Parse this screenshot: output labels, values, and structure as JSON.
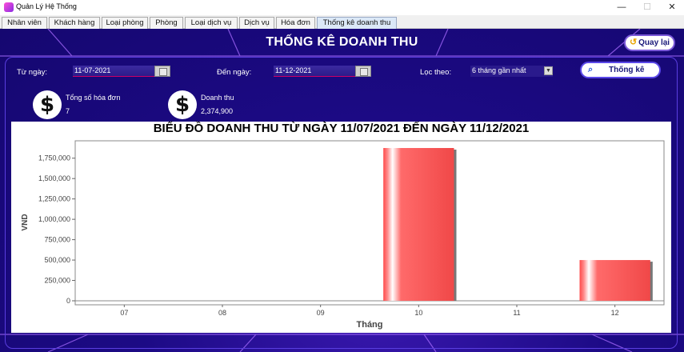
{
  "window": {
    "title": "Quản Lý Hệ Thống",
    "min": "—",
    "max": "☐",
    "close": "✕"
  },
  "tabs": [
    {
      "label": "Nhân viên"
    },
    {
      "label": "Khách hàng"
    },
    {
      "label": "Loại phòng"
    },
    {
      "label": "Phòng"
    },
    {
      "label": "Loại dịch vụ"
    },
    {
      "label": "Dịch vụ"
    },
    {
      "label": "Hóa đơn"
    },
    {
      "label": "Thống kê doanh thu",
      "active": true
    }
  ],
  "header": {
    "title": "THỐNG KÊ DOANH THU",
    "back_label": "Quay lại",
    "back_icon": "undo-arrow-icon"
  },
  "filters": {
    "from_label": "Từ ngày:",
    "from_value": "11-07-2021",
    "to_label": "Đến ngày:",
    "to_value": "11-12-2021",
    "filter_label": "Lọc theo:",
    "filter_value": "6 tháng gần nhất",
    "submit_label": "Thống kê",
    "submit_icon": "search-icon"
  },
  "stats": {
    "invoices_label": "Tổng số hóa đơn",
    "invoices_value": "7",
    "revenue_label": "Doanh thu",
    "revenue_value": "2,374,900",
    "icon_glyph": "$"
  },
  "colors": {
    "background": "#1c0a85",
    "bar": "#ff4a4a"
  },
  "chart_data": {
    "type": "bar",
    "title": "BIỂU ĐỒ DOANH THU TỪ NGÀY 11/07/2021 ĐẾN NGÀY 11/12/2021",
    "xlabel": "Tháng",
    "ylabel": "VND",
    "categories": [
      "07",
      "08",
      "09",
      "10",
      "11",
      "12"
    ],
    "values": [
      0,
      0,
      0,
      1874900,
      0,
      500000
    ],
    "ylim": [
      0,
      1875000
    ],
    "yticks": [
      0,
      250000,
      500000,
      750000,
      1000000,
      1250000,
      1500000,
      1750000
    ],
    "ytick_labels": [
      "0",
      "250,000",
      "500,000",
      "750,000",
      "1,000,000",
      "1,250,000",
      "1,500,000",
      "1,750,000"
    ],
    "grid": false,
    "legend": "none"
  }
}
